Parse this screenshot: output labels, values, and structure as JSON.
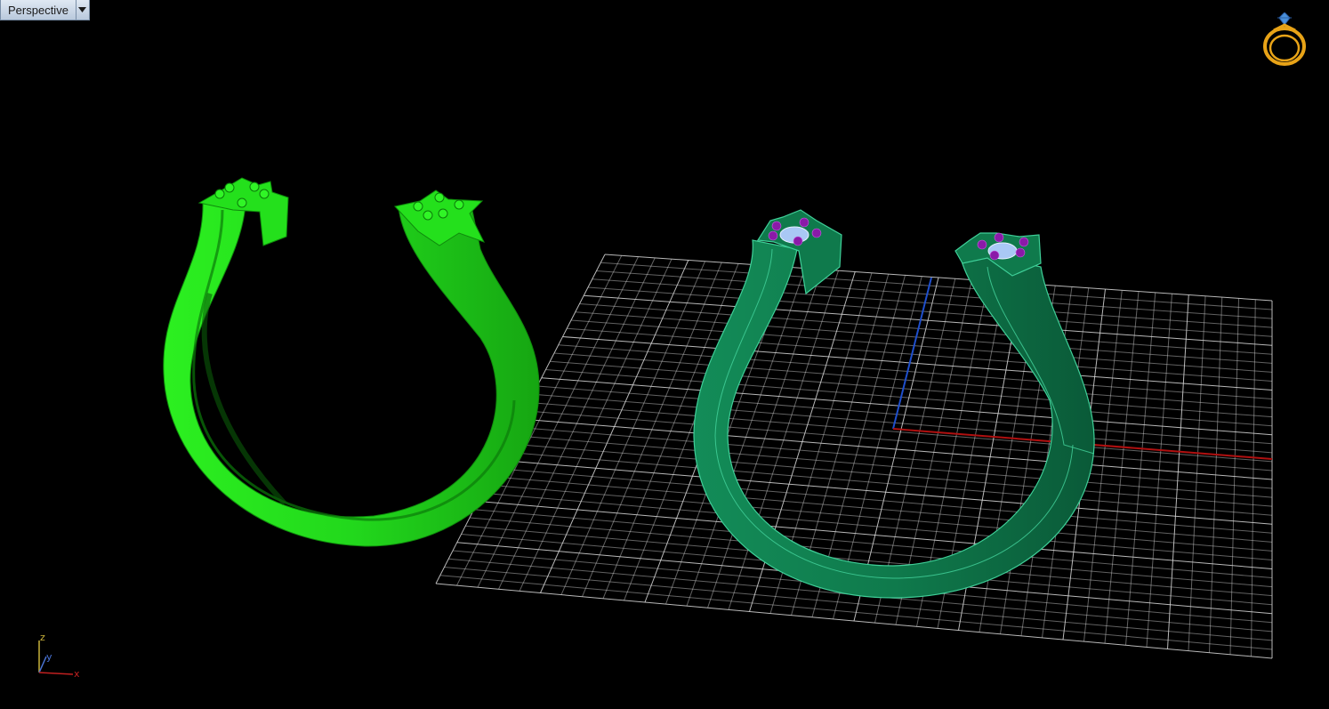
{
  "viewport": {
    "title": "Perspective",
    "menu_icon": "chevron-down-icon"
  },
  "logo": {
    "icon": "ring-diamond-logo-icon",
    "color": "#e8a317",
    "gem_color": "#4a90d9"
  },
  "axis": {
    "z_label": "z",
    "y_label": "y",
    "x_label": "x",
    "z_color": "#c9b23a",
    "y_color": "#4a74d6",
    "x_color": "#c02020"
  },
  "scene": {
    "background": "#000000",
    "grid_color": "#d8d8d8",
    "world_x_axis_color": "#b01010",
    "world_y_axis_color": "#1f4fcc",
    "ring_left_color": "#22d81c",
    "ring_right_color": "#0f7a4c",
    "gem_center_color": "#a9c8f5",
    "gem_prong_color": "#8a1aa8"
  }
}
